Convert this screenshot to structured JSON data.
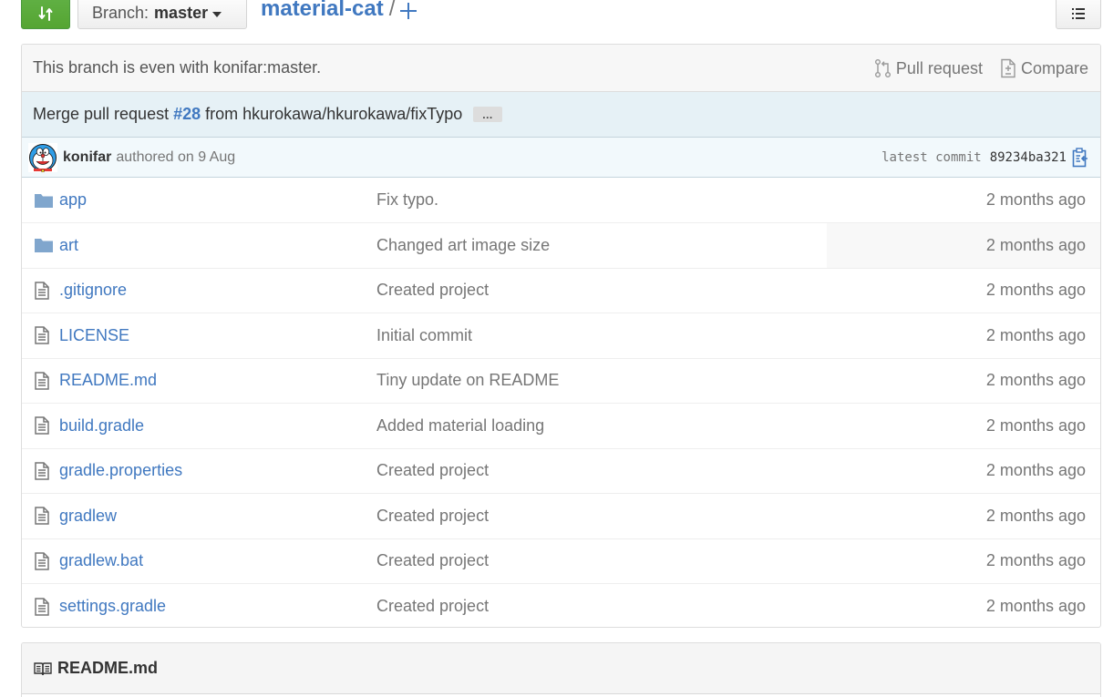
{
  "toolbar": {
    "branch_prefix": "Branch:",
    "branch_name": "master",
    "repo_name": "material-cat",
    "separator": "/"
  },
  "branch_info": {
    "status_text": "This branch is even with konifar:master.",
    "pull_request_label": "Pull request",
    "compare_label": "Compare"
  },
  "commit": {
    "title_prefix": "Merge pull request",
    "pr_number": "#28",
    "title_suffix": "from hkurokawa/hkurokawa/fixTypo",
    "ellipsis": "…",
    "author": "konifar",
    "authored_text": "authored on 9 Aug",
    "latest_label": "latest commit",
    "sha": "89234ba321"
  },
  "files": [
    {
      "type": "directory",
      "name": "app",
      "message": "Fix typo.",
      "age": "2 months ago"
    },
    {
      "type": "directory",
      "name": "art",
      "message": "Changed art image size",
      "age": "2 months ago"
    },
    {
      "type": "file",
      "name": ".gitignore",
      "message": "Created project",
      "age": "2 months ago"
    },
    {
      "type": "file",
      "name": "LICENSE",
      "message": "Initial commit",
      "age": "2 months ago"
    },
    {
      "type": "file",
      "name": "README.md",
      "message": "Tiny update on README",
      "age": "2 months ago"
    },
    {
      "type": "file",
      "name": "build.gradle",
      "message": "Added material loading",
      "age": "2 months ago"
    },
    {
      "type": "file",
      "name": "gradle.properties",
      "message": "Created project",
      "age": "2 months ago"
    },
    {
      "type": "file",
      "name": "gradlew",
      "message": "Created project",
      "age": "2 months ago"
    },
    {
      "type": "file",
      "name": "gradlew.bat",
      "message": "Created project",
      "age": "2 months ago"
    },
    {
      "type": "file",
      "name": "settings.gradle",
      "message": "Created project",
      "age": "2 months ago"
    }
  ],
  "readme": {
    "title": "README.md"
  },
  "icons": {
    "compare_button": "git-compare-icon",
    "list": "list-unordered-icon",
    "pull_request": "git-pull-request-icon",
    "compare": "diff-icon",
    "clipboard": "clippy-icon",
    "directory": "file-directory-icon",
    "file": "file-text-icon",
    "readme": "book-icon"
  },
  "colors": {
    "link": "#4078c0",
    "green_button": "#55a532",
    "commit_title_bg": "#e6f1f6",
    "commit_meta_bg": "#f2f9fc",
    "folder": "#80a6cd"
  }
}
